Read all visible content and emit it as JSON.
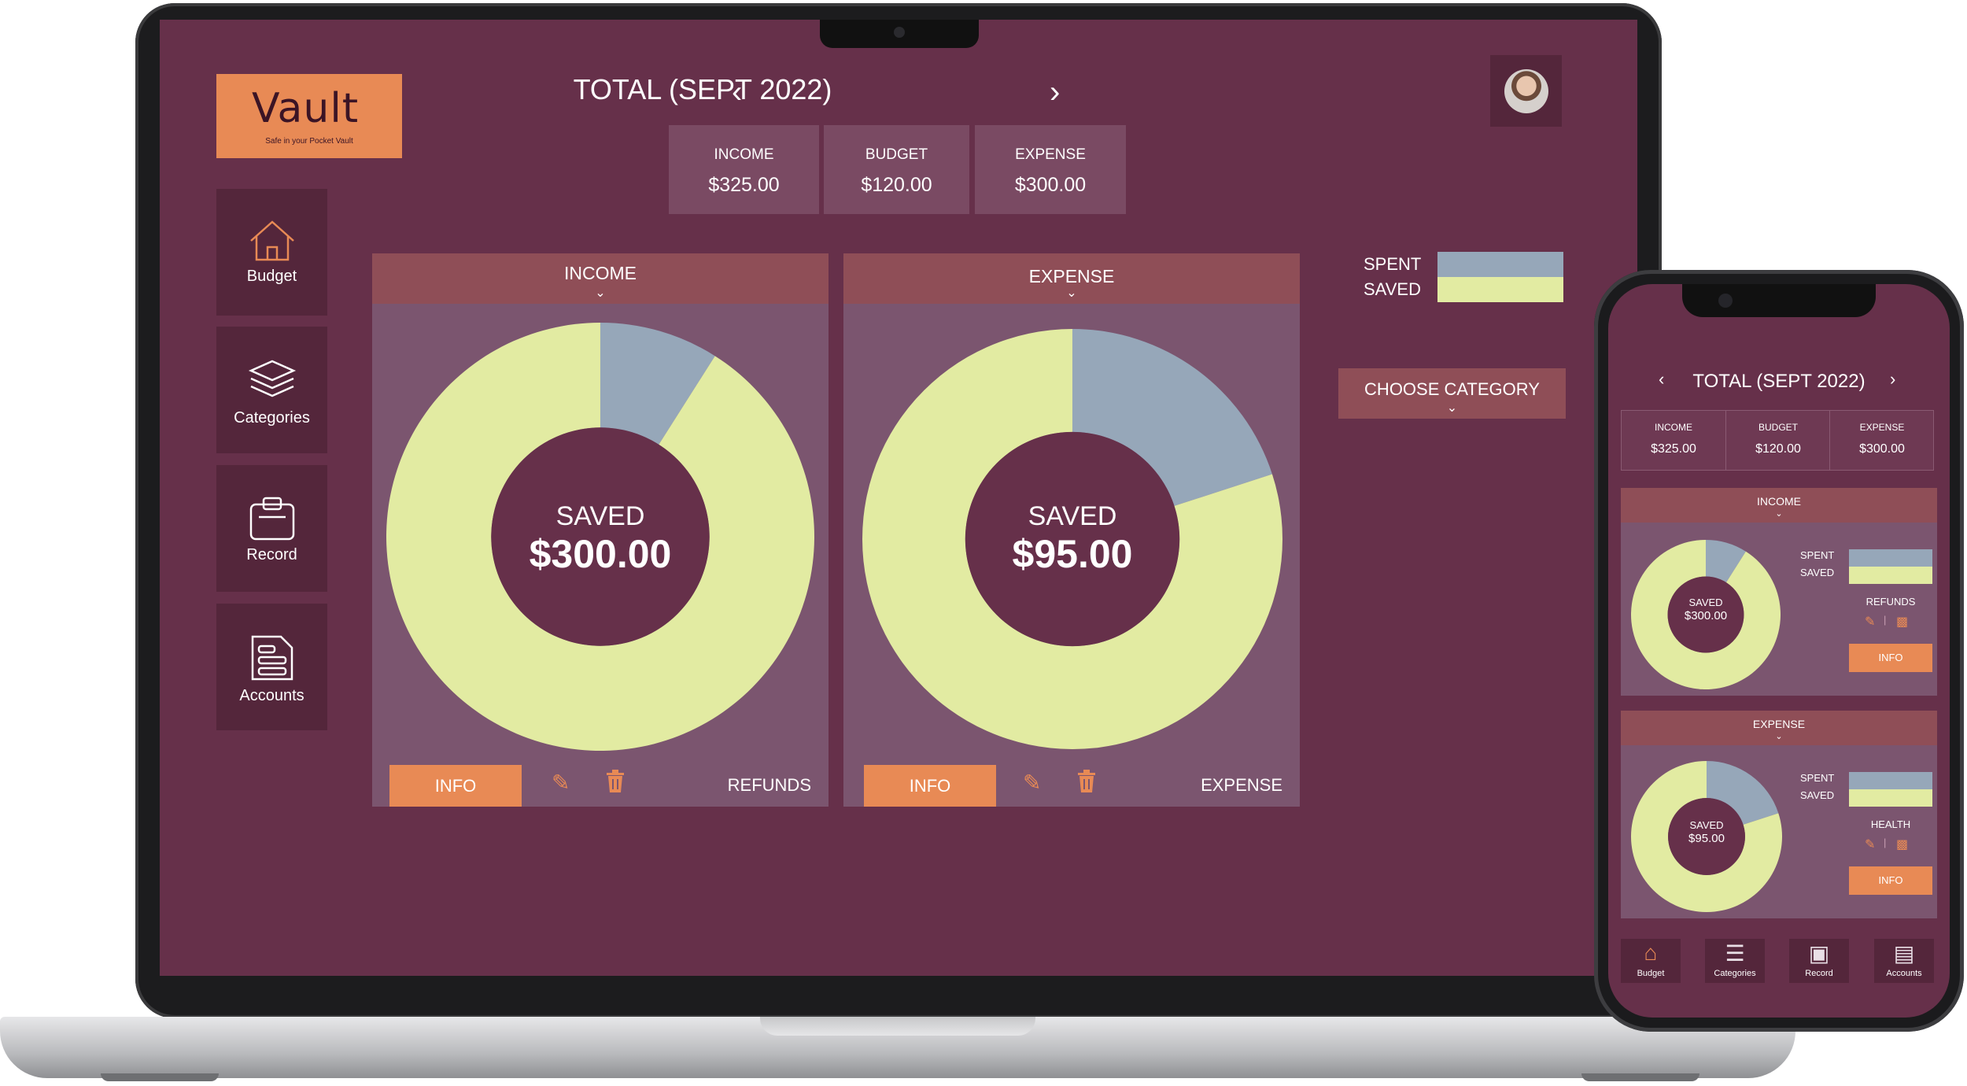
{
  "colors": {
    "background": "#66304a",
    "panel": "#54263b",
    "card": "#7b556f",
    "card_header": "#8f4e57",
    "accent": "#e88a55",
    "spent": "#96a7b9",
    "saved": "#e2eba2"
  },
  "logo": {
    "title": "Vault",
    "subtitle": "Safe in your Pocket Vault"
  },
  "header": {
    "title": "TOTAL (SEPT 2022)",
    "stats": [
      {
        "label": "INCOME",
        "value": "$325.00"
      },
      {
        "label": "BUDGET",
        "value": "$120.00"
      },
      {
        "label": "EXPENSE",
        "value": "$300.00"
      }
    ]
  },
  "sidebar": {
    "items": [
      {
        "label": "Budget",
        "icon": "home-icon"
      },
      {
        "label": "Categories",
        "icon": "layers-icon"
      },
      {
        "label": "Record",
        "icon": "clipboard-icon"
      },
      {
        "label": "Accounts",
        "icon": "document-icon"
      }
    ]
  },
  "legend": {
    "spent": "SPENT",
    "saved": "SAVED"
  },
  "choose_category": "CHOOSE CATEGORY",
  "cards": [
    {
      "title": "INCOME",
      "center_label": "SAVED",
      "center_value": "$300.00",
      "info": "INFO",
      "category": "REFUNDS",
      "spent_fraction": 0.09
    },
    {
      "title": "EXPENSE",
      "center_label": "SAVED",
      "center_value": "$95.00",
      "info": "INFO",
      "category": "EXPENSE",
      "spent_fraction": 0.2
    }
  ],
  "phone": {
    "title": "TOTAL (SEPT 2022)",
    "stats": [
      {
        "label": "INCOME",
        "value": "$325.00"
      },
      {
        "label": "BUDGET",
        "value": "$120.00"
      },
      {
        "label": "EXPENSE",
        "value": "$300.00"
      }
    ],
    "cards": [
      {
        "title": "INCOME",
        "center_label": "SAVED",
        "center_value": "$300.00",
        "category": "REFUNDS",
        "info": "INFO",
        "spent": "SPENT",
        "saved": "SAVED"
      },
      {
        "title": "EXPENSE",
        "center_label": "SAVED",
        "center_value": "$95.00",
        "category": "HEALTH",
        "info": "INFO",
        "spent": "SPENT",
        "saved": "SAVED"
      }
    ],
    "tabs": [
      {
        "label": "Budget"
      },
      {
        "label": "Categories"
      },
      {
        "label": "Record"
      },
      {
        "label": "Accounts"
      }
    ]
  }
}
